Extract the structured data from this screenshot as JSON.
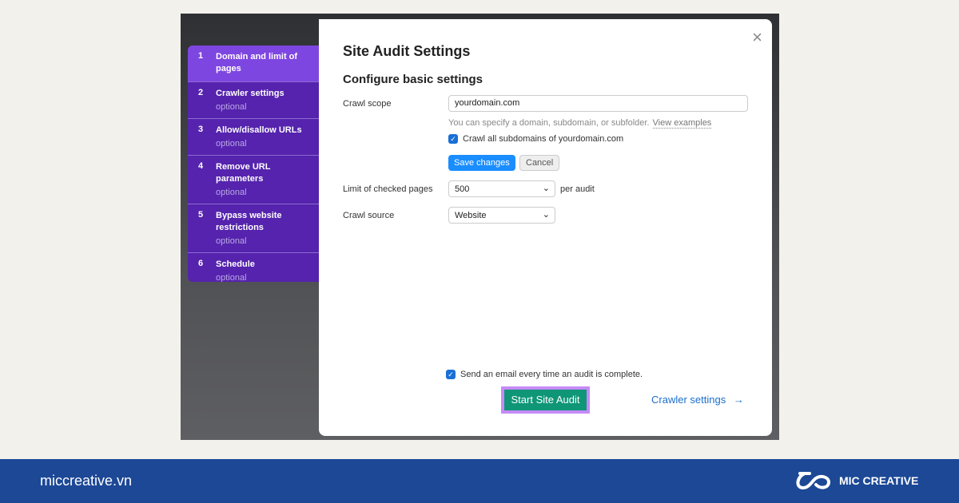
{
  "sidebar": {
    "steps": [
      {
        "num": "1",
        "title": "Domain and limit of pages",
        "sub": ""
      },
      {
        "num": "2",
        "title": "Crawler settings",
        "sub": "optional"
      },
      {
        "num": "3",
        "title": "Allow/disallow URLs",
        "sub": "optional"
      },
      {
        "num": "4",
        "title": "Remove URL parameters",
        "sub": "optional"
      },
      {
        "num": "5",
        "title": "Bypass website restrictions",
        "sub": "optional"
      },
      {
        "num": "6",
        "title": "Schedule",
        "sub": "optional"
      }
    ]
  },
  "modal": {
    "title": "Site Audit Settings",
    "subtitle": "Configure basic settings",
    "close": "×",
    "crawl_scope_label": "Crawl scope",
    "crawl_scope_value": "yourdomain.com",
    "hint": "You can specify a domain, subdomain, or subfolder.",
    "view_examples": "View examples",
    "subdomains_label": "Crawl all subdomains of yourdomain.com",
    "save": "Save changes",
    "cancel": "Cancel",
    "limit_label": "Limit of checked pages",
    "limit_value": "500",
    "per_audit": "per audit",
    "source_label": "Crawl source",
    "source_value": "Website",
    "email_label": "Send an email every time an audit is complete.",
    "start": "Start Site Audit",
    "crawler_link": "Crawler settings",
    "arrow": "→"
  },
  "footer": {
    "site": "miccreative.vn",
    "brand": "MIC CREATIVE"
  },
  "colors": {
    "active_step": "#7e46e0",
    "sidebar": "#5523ad",
    "start_button": "#0e9677",
    "footer": "#1c4896"
  }
}
